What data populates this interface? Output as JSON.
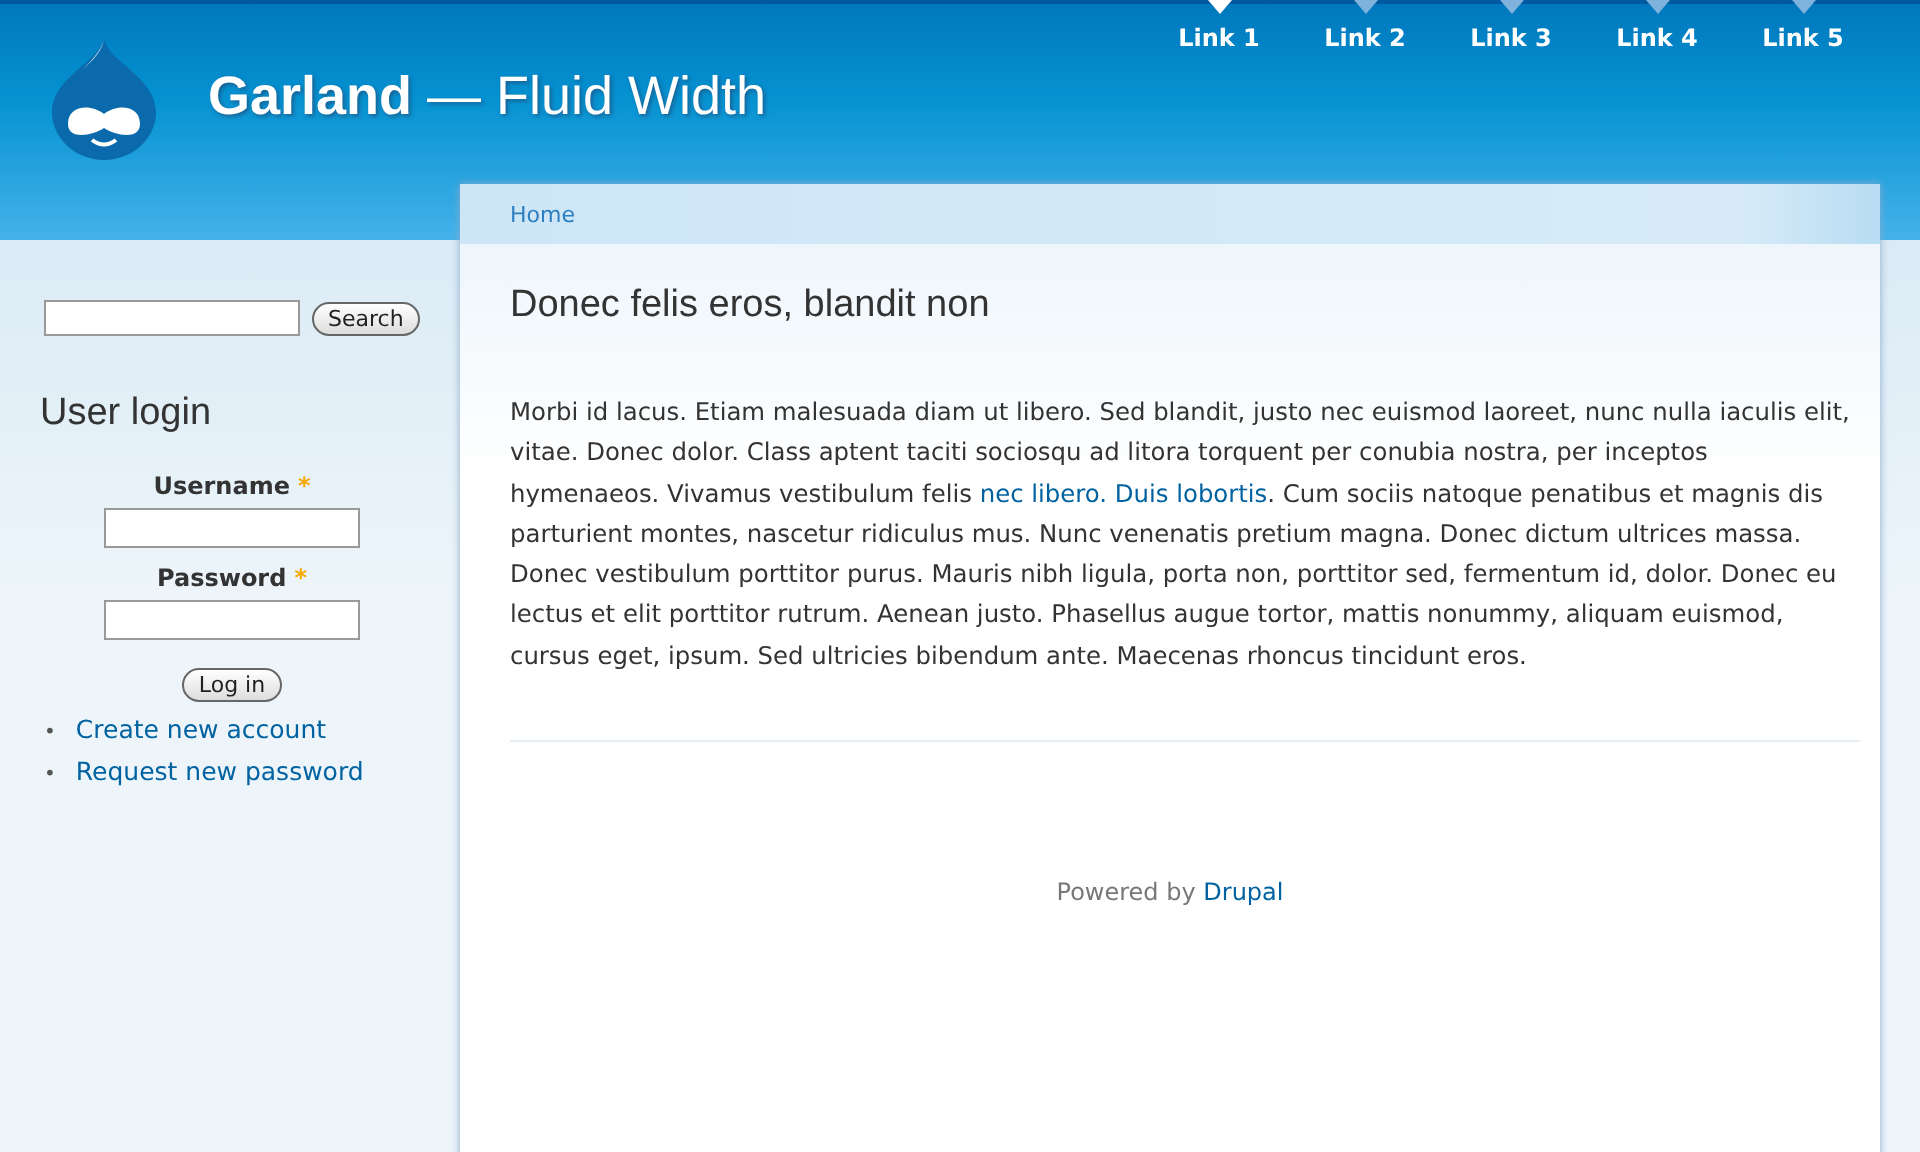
{
  "site": {
    "title": "**Garland** — Fluid Width"
  },
  "primary_links": [
    {
      "label": "Link 1",
      "selected": true
    },
    {
      "label": "Link 2",
      "selected": false
    },
    {
      "label": "Link 3",
      "selected": false
    },
    {
      "label": "Link 4",
      "selected": false
    },
    {
      "label": "Link 5",
      "selected": false
    }
  ],
  "search": {
    "button": "Search"
  },
  "user_login": {
    "title": "User login",
    "fields": [
      {
        "label": "Username",
        "required": true
      },
      {
        "label": "Password",
        "required": true
      }
    ],
    "required_mark": "*",
    "button": "Log in",
    "bullet": "•",
    "links": [
      "Create new account",
      "Request new password"
    ]
  },
  "breadcrumb": [
    "Home"
  ],
  "node": {
    "title": "Donec felis eros, blandit non",
    "body": [
      {
        "kind": "text",
        "text": "Morbi id lacus. Etiam malesuada diam ut libero. Sed blandit, justo nec euismod laoreet, nunc nulla iaculis elit, vitae. Donec dolor. Class aptent taciti sociosqu ad litora torquent per conubia nostra, per inceptos hymenaeos. Vivamus vestibulum felis "
      },
      {
        "kind": "link",
        "text": "nec libero. Duis lobortis"
      },
      {
        "kind": "text",
        "text": ". Cum sociis natoque penatibus et magnis dis parturient montes, nascetur ridiculus mus. Nunc venenatis pretium magna. Donec dictum ultrices massa. Donec vestibulum porttitor purus. Mauris nibh ligula, porta non, porttitor sed, fermentum id, dolor. Donec eu lectus et elit porttitor rutrum. Aenean justo. Phasellus augue tortor, mattis nonummy, aliquam euismod, cursus eget, ipsum. Sed ultricies bibendum ante. Maecenas rhoncus tincidunt eros."
      }
    ]
  },
  "footer": [
    {
      "kind": "text",
      "text": "Powered by "
    },
    {
      "kind": "link",
      "text": "Drupal"
    }
  ]
}
